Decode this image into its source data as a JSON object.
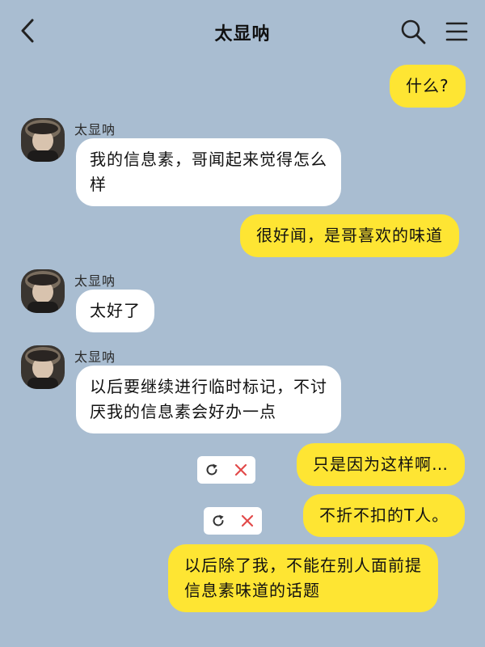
{
  "header": {
    "title": "太显呐",
    "back_icon": "chevron-left-icon",
    "search_icon": "search-icon",
    "menu_icon": "menu-icon"
  },
  "colors": {
    "background": "#a9bdd1",
    "my_bubble": "#fee533",
    "other_bubble": "#ffffff",
    "cancel_red": "#e24a4a"
  },
  "messages": [
    {
      "from": "me",
      "text": "什么?"
    },
    {
      "from": "other",
      "sender": "太显呐",
      "lines": [
        "我的信息素，哥闻起来觉得怎么",
        "样"
      ]
    },
    {
      "from": "me",
      "text": "很好闻，是哥喜欢的味道"
    },
    {
      "from": "other",
      "sender": "太显呐",
      "text": "太好了"
    },
    {
      "from": "other",
      "sender": "太显呐",
      "lines": [
        "以后要继续进行临时标记，不讨",
        "厌我的信息素会好办一点"
      ]
    },
    {
      "from": "me",
      "text": "只是因为这样啊…",
      "failed": true,
      "retry_icon": "retry-icon",
      "cancel_icon": "close-icon"
    },
    {
      "from": "me",
      "text": "不折不扣的T人。",
      "failed": true,
      "retry_icon": "retry-icon",
      "cancel_icon": "close-icon"
    },
    {
      "from": "me",
      "lines": [
        "以后除了我，不能在别人面前提",
        "信息素味道的话题"
      ]
    }
  ]
}
